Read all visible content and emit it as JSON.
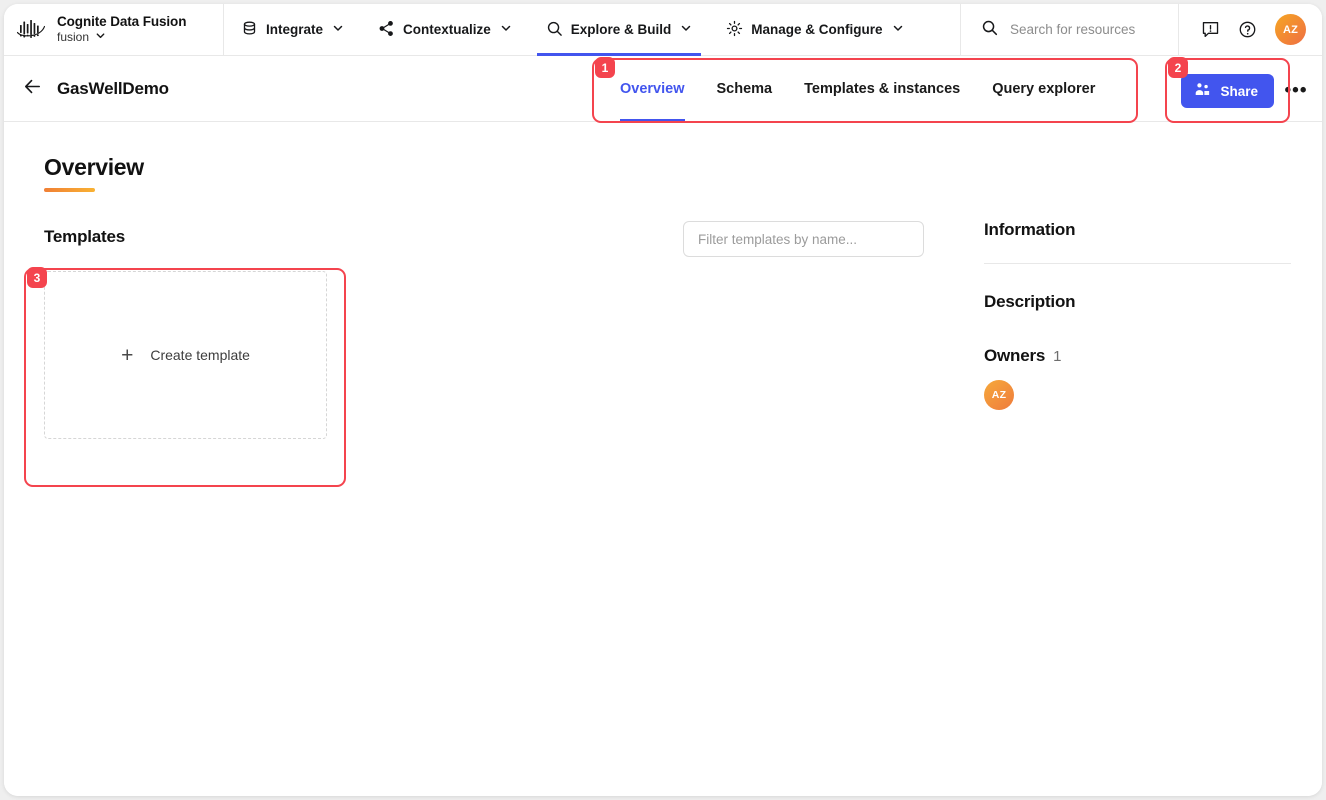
{
  "brand": {
    "logo_icon": "cognite-logo-icon",
    "title": "Cognite Data Fusion",
    "project": "fusion",
    "project_chevron": "chevron-down-icon"
  },
  "nav": {
    "items": [
      {
        "label": "Integrate",
        "icon": "database-icon",
        "chevron": "chevron-down-icon",
        "active": false
      },
      {
        "label": "Contextualize",
        "icon": "share-nodes-icon",
        "chevron": "chevron-down-icon",
        "active": false
      },
      {
        "label": "Explore & Build",
        "icon": "search-icon",
        "chevron": "chevron-down-icon",
        "active": true
      },
      {
        "label": "Manage & Configure",
        "icon": "gear-icon",
        "chevron": "chevron-down-icon",
        "active": false
      }
    ]
  },
  "search": {
    "icon": "search-icon",
    "placeholder": "Search for resources",
    "value": ""
  },
  "top_actions": {
    "feedback_icon": "feedback-icon",
    "help_icon": "help-circle-icon",
    "avatar_initials": "AZ"
  },
  "subheader": {
    "back_icon": "arrow-left-icon",
    "title": "GasWellDemo",
    "tabs": [
      {
        "label": "Overview",
        "active": true
      },
      {
        "label": "Schema",
        "active": false
      },
      {
        "label": "Templates & instances",
        "active": false
      },
      {
        "label": "Query explorer",
        "active": false
      }
    ],
    "share_label": "Share",
    "share_icon": "people-group-icon",
    "more_icon": "ellipsis-icon",
    "more_label": "•••"
  },
  "main": {
    "page_title": "Overview",
    "templates_label": "Templates",
    "filter": {
      "placeholder": "Filter templates by name...",
      "value": ""
    },
    "create_card": {
      "plus_icon": "plus-icon",
      "plus_glyph": "+",
      "label": "Create template"
    }
  },
  "information": {
    "title": "Information",
    "description_label": "Description",
    "description_value": "",
    "owners_label": "Owners",
    "owners_count": "1",
    "owners": [
      {
        "initials": "AZ"
      }
    ]
  },
  "annotations": [
    {
      "id": "1",
      "label": "1",
      "target": "tabs-group"
    },
    {
      "id": "2",
      "label": "2",
      "target": "share-button"
    },
    {
      "id": "3",
      "label": "3",
      "target": "create-template-card"
    }
  ],
  "colors": {
    "accent_blue": "#4255ee",
    "annotation_red": "#f4444e",
    "avatar_orange_start": "#f5a623",
    "avatar_orange_end": "#ef6e43",
    "underline_orange_start": "#f07f35",
    "underline_orange_end": "#f9b233"
  }
}
